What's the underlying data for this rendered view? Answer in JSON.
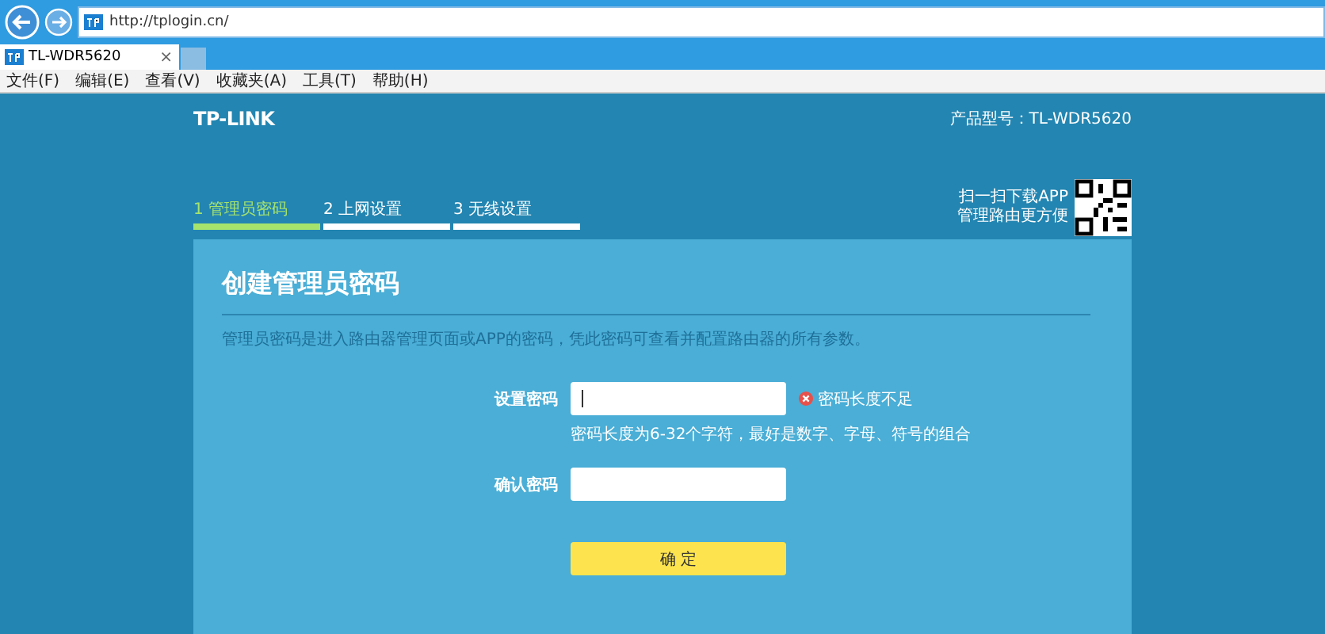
{
  "browser": {
    "address": "http://tplogin.cn/",
    "tab_title": "TL-WDR5620",
    "tab_close": "×",
    "menu": [
      "文件(F)",
      "编辑(E)",
      "查看(V)",
      "收藏夹(A)",
      "工具(T)",
      "帮助(H)"
    ]
  },
  "header": {
    "logo": "TP-LINK",
    "model": "产品型号：TL-WDR5620",
    "app_promo": [
      "扫一扫下载APP",
      "管理路由更方便"
    ]
  },
  "steps": [
    {
      "label": "1 管理员密码",
      "selected": true
    },
    {
      "label": "2 上网设置",
      "selected": false
    },
    {
      "label": "3 无线设置",
      "selected": false
    }
  ],
  "form": {
    "title": "创建管理员密码",
    "description": "管理员密码是进入路由器管理页面或APP的密码，凭此密码可查看并配置路由器的所有参数。",
    "fields": [
      {
        "label": "设置密码",
        "error": "密码长度不足",
        "hint": "密码长度为6-32个字符，最好是数字、字母、符号的组合"
      },
      {
        "label": "确认密码"
      }
    ],
    "submit": "确 定"
  }
}
